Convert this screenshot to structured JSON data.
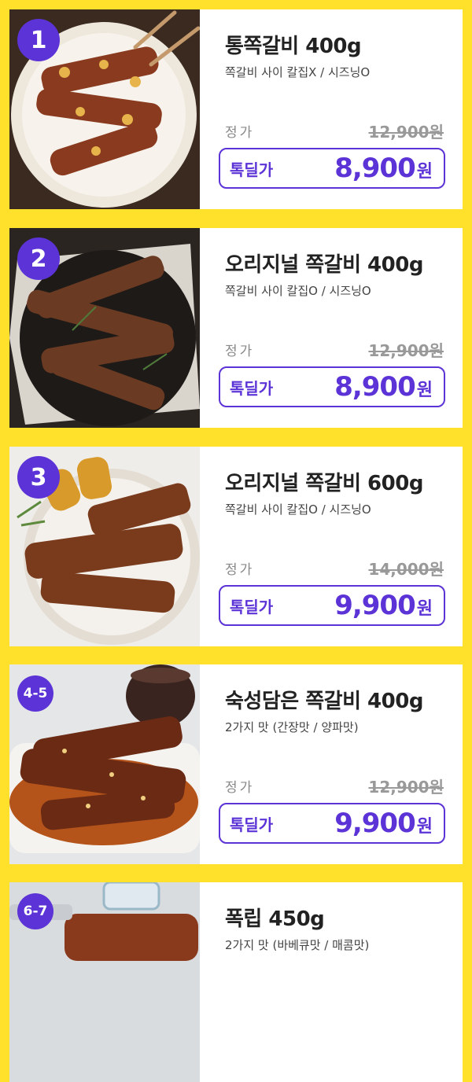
{
  "products": [
    {
      "badge": "1",
      "title": "통쪽갈비 400g",
      "subtitle": "쪽갈비 사이 칼집X / 시즈닝O",
      "regular_label": "정가",
      "regular_price": "12,900원",
      "deal_label": "톡딜가",
      "deal_price": "8,900",
      "currency": "원"
    },
    {
      "badge": "2",
      "title": "오리지널 쪽갈비 400g",
      "subtitle": "쪽갈비 사이 칼집O  / 시즈닝O",
      "regular_label": "정가",
      "regular_price": "12,900원",
      "deal_label": "톡딜가",
      "deal_price": "8,900",
      "currency": "원"
    },
    {
      "badge": "3",
      "title": "오리지널 쪽갈비 600g",
      "subtitle": "쪽갈비 사이 칼집O  / 시즈닝O",
      "regular_label": "정가",
      "regular_price": "14,000원",
      "deal_label": "톡딜가",
      "deal_price": "9,900",
      "currency": "원"
    },
    {
      "badge": "4-5",
      "title": "숙성담은 쪽갈비 400g",
      "subtitle": "2가지 맛 (간장맛 / 양파맛)",
      "regular_label": "정가",
      "regular_price": "12,900원",
      "deal_label": "톡딜가",
      "deal_price": "9,900",
      "currency": "원"
    },
    {
      "badge": "6-7",
      "title": "폭립 450g",
      "subtitle": "2가지 맛 (바베큐맛 / 매콤맛)"
    }
  ],
  "colors": {
    "background": "#FFE02A",
    "accent": "#5B33D6",
    "card": "#FFFFFF"
  }
}
